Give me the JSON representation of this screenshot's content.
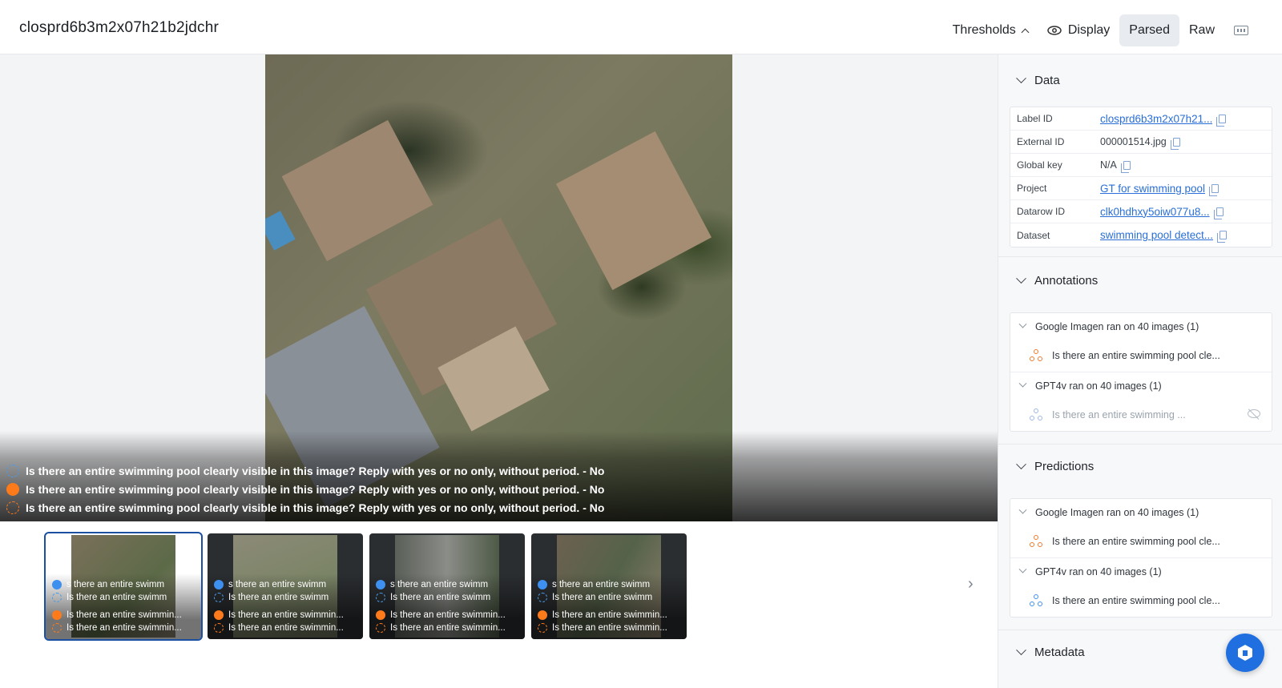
{
  "header": {
    "title": "closprd6b3m2x07h21b2jdchr",
    "thresholds_label": "Thresholds",
    "display_label": "Display",
    "parsed_label": "Parsed",
    "raw_label": "Raw"
  },
  "viewer": {
    "labels": [
      {
        "style": "blue-dashed",
        "text": "Is there an entire swimming pool clearly visible in this image? Reply with yes or no only, without period. - No"
      },
      {
        "style": "orange-solid",
        "text": "Is there an entire swimming pool clearly visible in this image? Reply with yes or no only, without period. - No"
      },
      {
        "style": "orange-dashed",
        "text": "Is there an entire swimming pool clearly visible in this image? Reply with yes or no only, without period. - No"
      }
    ],
    "thumbnails": [
      {
        "r1": "s there an entire swimm",
        "r2": "Is there an entire swimm",
        "r3": "Is there an entire swimmin...",
        "r4": "Is there an entire swimmin..."
      },
      {
        "r1": "s there an entire swimm",
        "r2": "Is there an entire swimm",
        "r3": "Is there an entire swimmin...",
        "r4": "Is there an entire swimmin..."
      },
      {
        "r1": "s there an entire swimm",
        "r2": "Is there an entire swimm",
        "r3": "Is there an entire swimmin...",
        "r4": "Is there an entire swimmin..."
      },
      {
        "r1": "s there an entire swimm",
        "r2": "Is there an entire swimm",
        "r3": "Is there an entire swimmin...",
        "r4": "Is there an entire swimmin..."
      }
    ]
  },
  "sidebar": {
    "data_section": {
      "title": "Data",
      "rows": [
        {
          "key": "Label ID",
          "value": "closprd6b3m2x07h21...",
          "link": true
        },
        {
          "key": "External ID",
          "value": "000001514.jpg",
          "link": false
        },
        {
          "key": "Global key",
          "value": "N/A",
          "link": false
        },
        {
          "key": "Project",
          "value": "GT for swimming pool",
          "link": true
        },
        {
          "key": "Datarow ID",
          "value": "clk0hdhxy5oiw077u8...",
          "link": true
        },
        {
          "key": "Dataset",
          "value": "swimming pool detect...",
          "link": true
        }
      ]
    },
    "annotations": {
      "title": "Annotations",
      "groups": [
        {
          "title": "Google Imagen ran on 40 images (1)",
          "item": "Is there an entire swimming pool cle...",
          "color": "#f07a2a",
          "muted": false
        },
        {
          "title": "GPT4v ran on 40 images (1)",
          "item": "Is there an entire swimming ...",
          "color": "#9bb8e6",
          "muted": true
        }
      ]
    },
    "predictions": {
      "title": "Predictions",
      "groups": [
        {
          "title": "Google Imagen ran on 40 images (1)",
          "item": "Is there an entire swimming pool cle...",
          "color": "#f07a2a",
          "muted": false
        },
        {
          "title": "GPT4v ran on 40 images (1)",
          "item": "Is there an entire swimming pool cle...",
          "color": "#3d8ff0",
          "muted": false
        }
      ]
    },
    "metadata": {
      "title": "Metadata"
    }
  },
  "colors": {
    "accent": "#1f6fe0",
    "link": "#2a6fd6",
    "orange": "#ff7a1a",
    "blue": "#3d8ff0"
  }
}
